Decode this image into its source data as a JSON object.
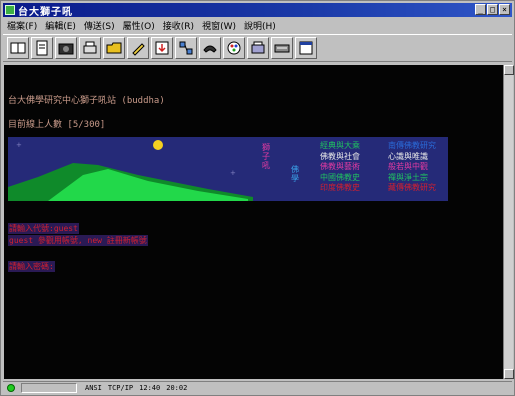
{
  "window": {
    "title": "台大獅子吼"
  },
  "controls": {
    "minimize": "_",
    "maximize": "□",
    "close": "×"
  },
  "menu": [
    "檔案(F)",
    "編輯(E)",
    "傳送(S)",
    "屬性(O)",
    "接收(R)",
    "視窗(W)",
    "說明(H)"
  ],
  "toolbar": [
    {
      "icon": "connect-icon"
    },
    {
      "icon": "document-icon"
    },
    {
      "icon": "camera-icon"
    },
    {
      "icon": "print-icon"
    },
    {
      "icon": "folder-icon"
    },
    {
      "icon": "pencil-icon"
    },
    {
      "icon": "download-icon"
    },
    {
      "icon": "network-icon"
    },
    {
      "icon": "phone-icon"
    },
    {
      "icon": "palette-icon"
    },
    {
      "icon": "printer-icon"
    },
    {
      "icon": "keyboard-icon"
    },
    {
      "icon": "window-icon"
    }
  ],
  "terminal": {
    "welcome": "台大佛學研究中心獅子吼站 (buddha)",
    "online": "目前線上人數 [5/300]",
    "banner": {
      "vertical_left": "獅子吼",
      "vertical_right": "佛學",
      "col1": [
        {
          "text": "經典與大乘",
          "color": "#20c060"
        },
        {
          "text": "佛教與社會",
          "color": "#e8e8e8"
        },
        {
          "text": "佛教與藝術",
          "color": "#e03aa0"
        },
        {
          "text": "中國佛教史",
          "color": "#20c060"
        },
        {
          "text": "印度佛教史",
          "color": "#d02030"
        }
      ],
      "col2": [
        {
          "text": "南傳佛教研究",
          "color": "#2a6ad8"
        },
        {
          "text": "心識與唯識",
          "color": "#e8e8e8"
        },
        {
          "text": "般若與中觀",
          "color": "#e03aa0"
        },
        {
          "text": "禪與淨土宗",
          "color": "#20c060"
        },
        {
          "text": "藏傳佛教研究",
          "color": "#d02030"
        }
      ]
    },
    "login_lines": [
      "請輸入代號:guest",
      "guest 參觀用帳號, new 註冊新帳號",
      "請輸入密碼:"
    ]
  },
  "status": {
    "emulation": "ANSI",
    "connection": "TCP/IP",
    "position": "12:40",
    "time": "20:02"
  },
  "colors": {
    "titlebar": "#0a1a8a",
    "terminal_bg": "#040404",
    "banner_bg": "#252a78",
    "hill_dark": "#0f8a2a",
    "hill_light": "#22d84a",
    "moon": "#f4d020"
  }
}
